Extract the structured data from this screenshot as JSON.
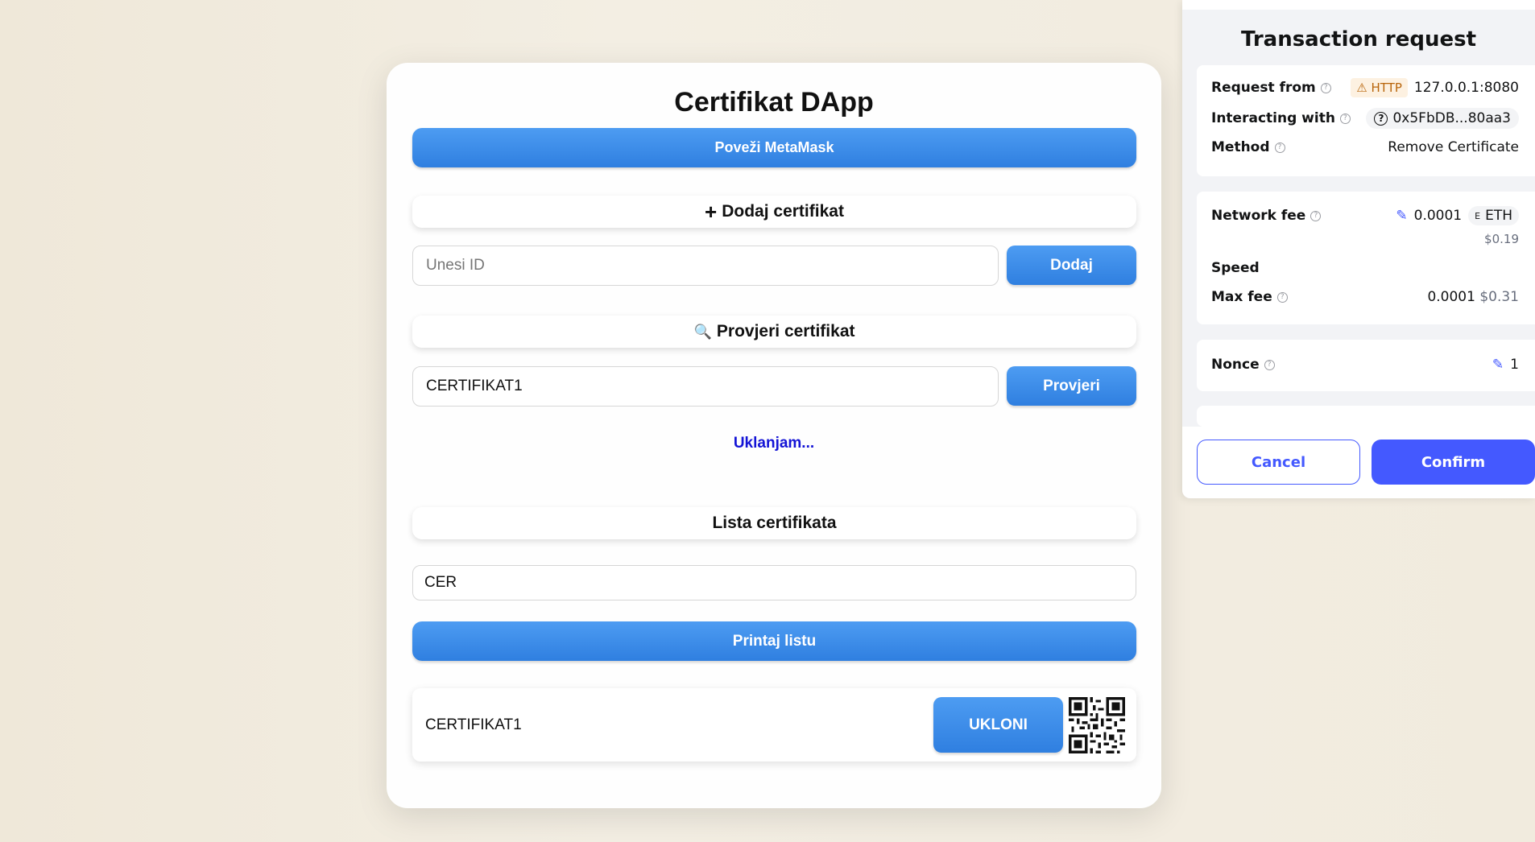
{
  "dapp": {
    "title": "Certifikat DApp",
    "connect_label": "Poveži MetaMask",
    "add_section": {
      "icon": "+",
      "title": "Dodaj certifikat"
    },
    "add_input": {
      "value": "",
      "placeholder": "Unesi ID"
    },
    "add_button": "Dodaj",
    "check_section": {
      "icon": "🔍",
      "title": "Provjeri certifikat"
    },
    "check_input": {
      "value": "CERTIFIKAT1"
    },
    "check_button": "Provjeri",
    "status_text": "Uklanjam...",
    "list_section": {
      "title": "Lista certifikata"
    },
    "list_input": {
      "value": "CER"
    },
    "print_button": "Printaj listu",
    "certificates": [
      {
        "name": "CERTIFIKAT1",
        "remove_label": "UKLONI"
      }
    ]
  },
  "metamask": {
    "title": "Transaction request",
    "request_from": {
      "label": "Request from",
      "badge": "HTTP",
      "value": "127.0.0.1:8080"
    },
    "interacting_with": {
      "label": "Interacting with",
      "value": "0x5FbDB...80aa3"
    },
    "method": {
      "label": "Method",
      "value": "Remove Certificate"
    },
    "network_fee": {
      "label": "Network fee",
      "value": "0.0001",
      "currency_icon": "E",
      "currency": "ETH",
      "fiat": "$0.19"
    },
    "speed": {
      "label": "Speed"
    },
    "max_fee": {
      "label": "Max fee",
      "value": "0.0001",
      "fiat": "$0.31"
    },
    "nonce": {
      "label": "Nonce",
      "value": "1"
    },
    "cancel_label": "Cancel",
    "confirm_label": "Confirm"
  },
  "colors": {
    "background": "#f1ebde",
    "dapp_button": "#2f7fe0",
    "status_text": "#1414d6",
    "metamask_accent": "#4459ff",
    "http_badge": "#b8650b"
  }
}
